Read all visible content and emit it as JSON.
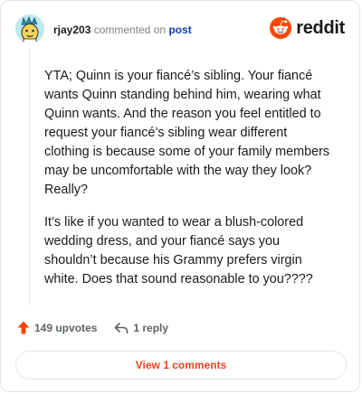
{
  "comment": {
    "username": "rjay203",
    "action_text": "commented on",
    "post_link": "post",
    "paragraphs": [
      "YTA; Quinn is your fiancé’s sibling. Your fiancé wants Quinn standing behind him, wearing what Quinn wants. And the reason you feel entitled to request your fiancé’s sibling wear different clothing is because some of your family members may be uncomfortable with the way they look? Really?",
      "It’s like if you wanted to wear a blush-colored wedding dress, and your fiancé says you shouldn’t because his Grammy prefers virgin white. Does that sound reasonable to you????"
    ]
  },
  "brand": {
    "name": "reddit",
    "color": "#ff4500"
  },
  "actions": {
    "upvotes": "149 upvotes",
    "replies": "1 reply",
    "upvote_icon": "upvote-arrow-icon",
    "reply_icon": "reply-arrow-icon"
  },
  "footer": {
    "view_comments": "View 1 comments"
  },
  "colors": {
    "upvote": "#ff4500",
    "link": "#0f3fa8",
    "view_button_text": "#e8431f"
  }
}
